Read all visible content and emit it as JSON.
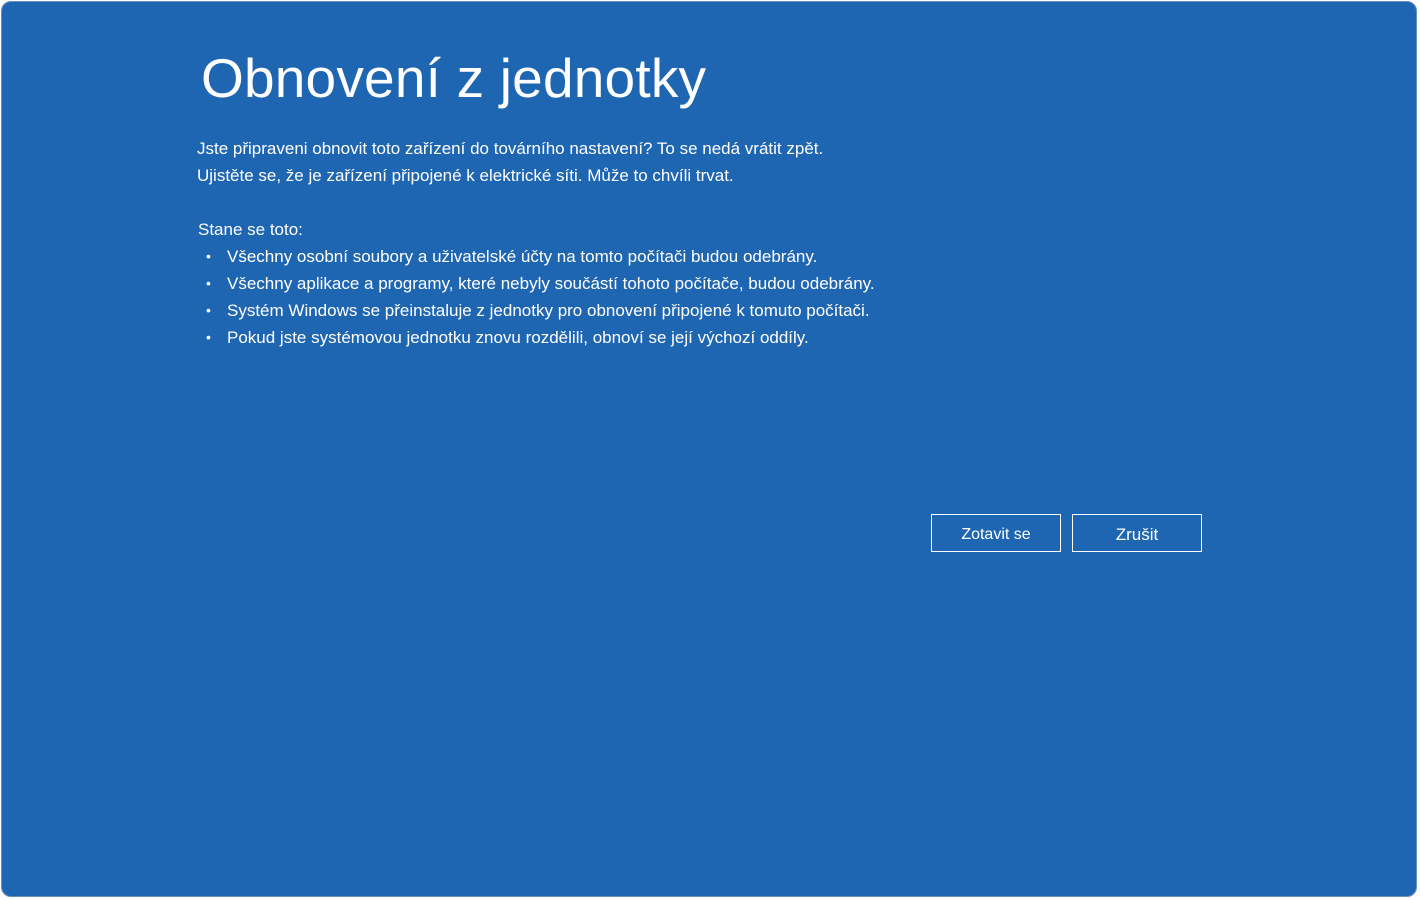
{
  "page": {
    "title": "Obnovení z jednotky",
    "intro_lines": [
      "Jste připraveni obnovit toto zařízení do továrního nastavení? To se nedá vrátit zpět.",
      "Ujistěte se, že je zařízení připojené k elektrické síti. Může to chvíli trvat."
    ],
    "section_heading": "Stane se toto:",
    "bullet_glyph": "•",
    "bullets": [
      "Všechny osobní soubory a uživatelské účty na tomto počítači budou odebrány.",
      "Všechny aplikace a programy, které nebyly součástí tohoto počítače, budou odebrány.",
      "Systém Windows se přeinstaluje z jednotky pro obnovení připojené k tomuto počítači.",
      "Pokud jste systémovou jednotku znovu rozdělili, obnoví se její výchozí oddíly."
    ]
  },
  "buttons": {
    "recover_label": "Zotavit se",
    "cancel_label": "Zrušit"
  },
  "colors": {
    "background": "#1f66b2",
    "text": "#ffffff"
  }
}
